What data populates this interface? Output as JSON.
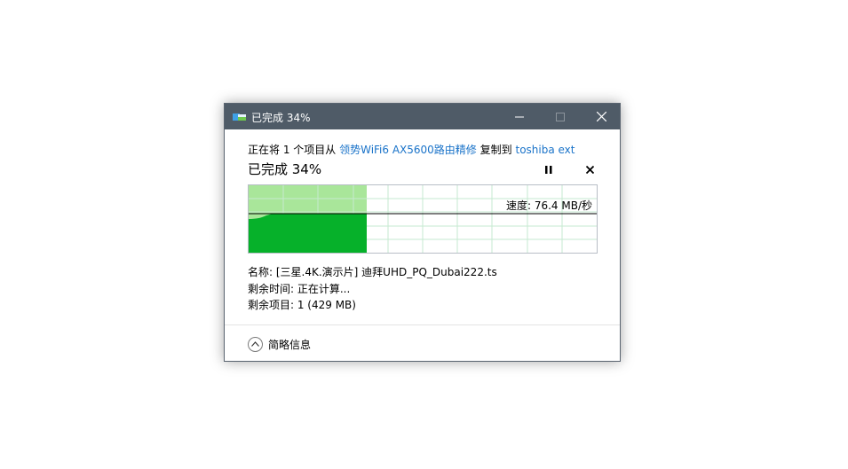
{
  "window": {
    "title": "已完成 34%"
  },
  "copy_line": {
    "prefix": "正在将 1 个项目从",
    "source": "领势WiFi6 AX5600路由精修",
    "middle": "复制到",
    "destination": "toshiba ext"
  },
  "progress": {
    "heading": "已完成 34%",
    "percent": 34,
    "speed": "速度: 76.4 MB/秒"
  },
  "details": {
    "name": "名称: [三星.4K.演示片] 迪拜UHD_PQ_Dubai222.ts",
    "time_remaining": "剩余时间: 正在计算...",
    "items_remaining": "剩余项目: 1 (429 MB)"
  },
  "footer": {
    "toggle_label": "简略信息"
  },
  "colors": {
    "titlebar": "#4f5b67",
    "progress_fill": "#a9e69a",
    "speed_fill": "#06b12a",
    "link": "#1a73c9"
  },
  "icons": {
    "app": "copy-files-icon",
    "pause": "pause-icon",
    "stop": "close-icon",
    "toggle": "chevron-up-icon"
  }
}
